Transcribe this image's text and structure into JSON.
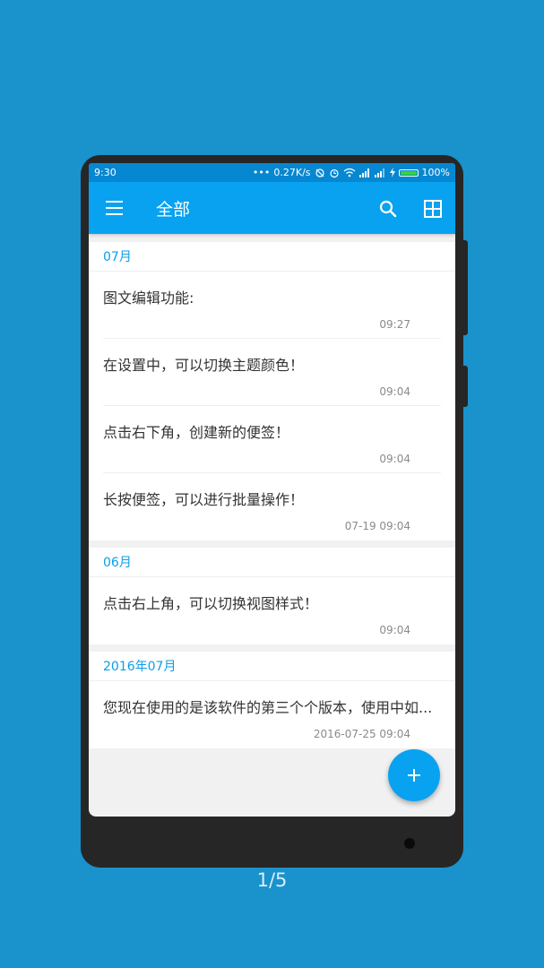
{
  "status": {
    "time": "9:30",
    "dots": "•••",
    "speed": "0.27K/s",
    "battery": "100%"
  },
  "appbar": {
    "title": "全部"
  },
  "sections": [
    {
      "header": "07月",
      "notes": [
        {
          "text": "图文编辑功能:",
          "time": "09:27"
        },
        {
          "text": "在设置中，可以切换主题颜色！",
          "time": "09:04"
        },
        {
          "text": "点击右下角，创建新的便签！",
          "time": "09:04"
        },
        {
          "text": "长按便签，可以进行批量操作！",
          "time": "07-19 09:04"
        }
      ]
    },
    {
      "header": "06月",
      "notes": [
        {
          "text": "点击右上角，可以切换视图样式！",
          "time": "09:04"
        }
      ]
    },
    {
      "header": "2016年07月",
      "notes": [
        {
          "text": "您现在使用的是该软件的第三个个版本，使用中如...",
          "time": "2016-07-25 09:04"
        }
      ]
    }
  ],
  "pager": "1/5",
  "colors": {
    "background": "#1a92cc",
    "primary": "#08a2f0",
    "statusbar": "#0687d1",
    "accent_text": "#0a9ee9"
  }
}
